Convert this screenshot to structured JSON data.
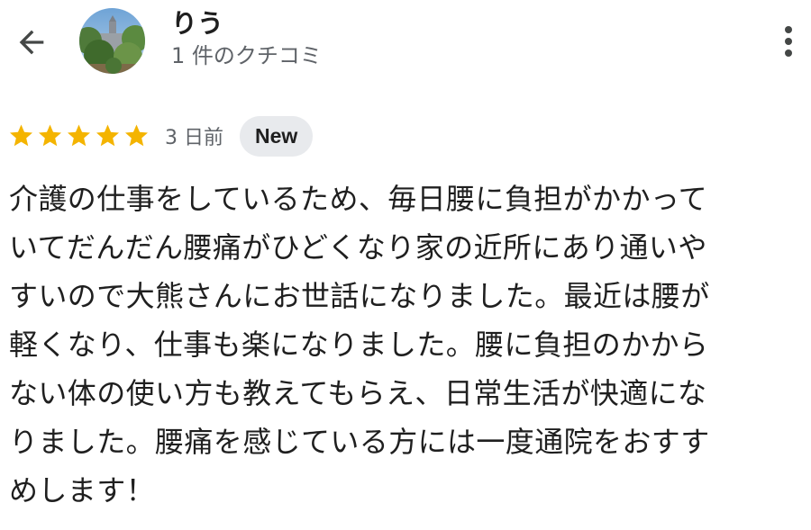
{
  "header": {
    "back_icon": "arrow-back-icon",
    "user_name": "りう",
    "review_count": "1 件のクチコミ",
    "more_icon": "more-vert-icon"
  },
  "review": {
    "rating": 5,
    "max_rating": 5,
    "star_color": "#f4b400",
    "time_ago": "3 日前",
    "badge": "New",
    "text": "介護の仕事をしているため、毎日腰に負担がかかって\nいてだんだん腰痛がひどくなり家の近所にあり通いや\nすいので大熊さんにお世話になりました。最近は腰が\n軽くなり、仕事も楽になりました。腰に負担のかから\nない体の使い方も教えてもらえ、日常生活が快適にな\nりました。腰痛を感じている方には一度通院をおすす\nめします！"
  }
}
